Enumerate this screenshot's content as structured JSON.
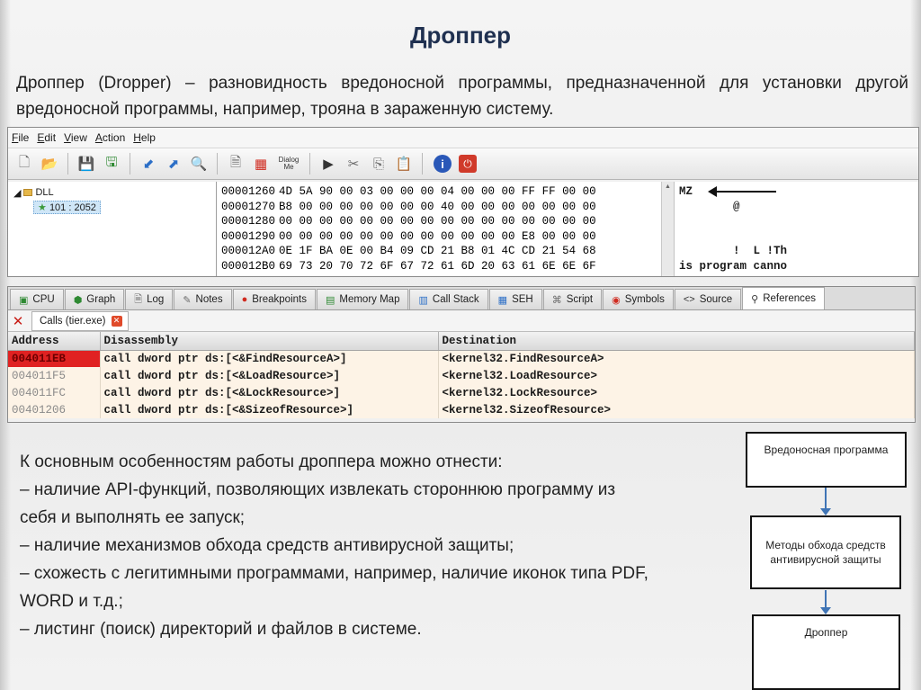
{
  "title": "Дроппер",
  "intro": "Дроппер (Dropper) – разновидность вредоносной программы, предназначенной для установки другой вредоносной программы, например, трояна в зараженную систему.",
  "hex_window": {
    "menu": [
      "File",
      "Edit",
      "View",
      "Action",
      "Help"
    ],
    "toolbar_dialog_label": "Dialog Me",
    "tree": {
      "root": "DLL",
      "child": "101 : 2052"
    },
    "rows": [
      {
        "addr": "00001260",
        "bytes": "4D 5A 90 00 03 00 00 00 04 00 00 00 FF FF 00 00",
        "ascii": "MZ"
      },
      {
        "addr": "00001270",
        "bytes": "B8 00 00 00 00 00 00 00 40 00 00 00 00 00 00 00",
        "ascii": "        @"
      },
      {
        "addr": "00001280",
        "bytes": "00 00 00 00 00 00 00 00 00 00 00 00 00 00 00 00",
        "ascii": ""
      },
      {
        "addr": "00001290",
        "bytes": "00 00 00 00 00 00 00 00 00 00 00 00 E8 00 00 00",
        "ascii": ""
      },
      {
        "addr": "000012A0",
        "bytes": "0E 1F BA 0E 00 B4 09 CD 21 B8 01 4C CD 21 54 68",
        "ascii": "        !  L !Th"
      },
      {
        "addr": "000012B0",
        "bytes": "69 73 20 70 72 6F 67 72 61 6D 20 63 61 6E 6E 6F",
        "ascii": "is program canno"
      }
    ]
  },
  "debugger": {
    "tabs": [
      "CPU",
      "Graph",
      "Log",
      "Notes",
      "Breakpoints",
      "Memory Map",
      "Call Stack",
      "SEH",
      "Script",
      "Symbols",
      "Source",
      "References"
    ],
    "active_tab": "References",
    "subtab": "Calls (tier.exe)",
    "columns": [
      "Address",
      "Disassembly",
      "Destination"
    ],
    "rows": [
      {
        "address": "004011EB",
        "disassembly": "call dword ptr ds:[<&FindResourceA>]",
        "destination": "<kernel32.FindResourceA>"
      },
      {
        "address": "004011F5",
        "disassembly": "call dword ptr ds:[<&LoadResource>]",
        "destination": "<kernel32.LoadResource>"
      },
      {
        "address": "004011FC",
        "disassembly": "call dword ptr ds:[<&LockResource>]",
        "destination": "<kernel32.LockResource>"
      },
      {
        "address": "00401206",
        "disassembly": "call dword ptr ds:[<&SizeofResource>]",
        "destination": "<kernel32.SizeofResource>"
      }
    ],
    "selected_row_index": 0,
    "selected_color": "#e02222"
  },
  "features": [
    "К основным особенностям работы дроппера можно отнести:",
    "– наличие API-функций, позволяющих извлекать стороннюю программу из себя и выполнять ее запуск;",
    "– наличие механизмов обхода средств антивирусной защиты;",
    "– схожесть с легитимными программами, например, наличие иконок типа PDF, WORD и т.д.;",
    "– листинг (поиск) директорий и файлов в системе."
  ],
  "flow": {
    "box1": "Вредоносная программа",
    "box2": "Методы обхода средств антивирусной защиты",
    "box3": "Дроппер",
    "arrow_color": "#3f74b5"
  },
  "colors": {
    "title": "#1f3050",
    "table_row_bg": "#fdf3e6"
  }
}
